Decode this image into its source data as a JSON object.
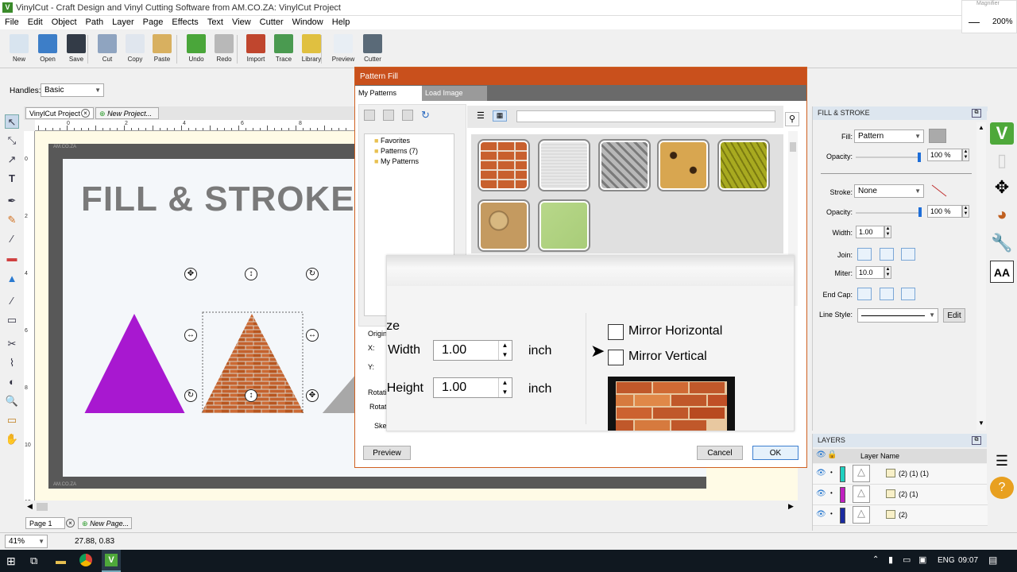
{
  "app": {
    "title": "VinylCut - Craft Design and Vinyl Cutting Software from AM.CO.ZA: VinylCut Project",
    "logo_letter": "V"
  },
  "menu": [
    "File",
    "Edit",
    "Object",
    "Path",
    "Layer",
    "Page",
    "Effects",
    "Text",
    "View",
    "Cutter",
    "Window",
    "Help"
  ],
  "toolbar": [
    {
      "label": "New",
      "icon": "new-file-icon",
      "color": "#d8e4ef"
    },
    {
      "label": "Open",
      "icon": "open-folder-icon",
      "color": "#3d7ec8"
    },
    {
      "label": "Save",
      "icon": "save-disk-icon",
      "color": "#333b47"
    },
    {
      "label": "Cut",
      "icon": "scissors-icon",
      "color": "#8fa4c0"
    },
    {
      "label": "Copy",
      "icon": "copy-icon",
      "color": "#e0e6ee"
    },
    {
      "label": "Paste",
      "icon": "paste-icon",
      "color": "#d8b060"
    },
    {
      "label": "Undo",
      "icon": "undo-icon",
      "color": "#4aa63a"
    },
    {
      "label": "Redo",
      "icon": "redo-icon",
      "color": "#b8b8b8"
    },
    {
      "label": "Import",
      "icon": "import-svg-icon",
      "color": "#c0462e"
    },
    {
      "label": "Trace",
      "icon": "trace-icon",
      "color": "#4a9a50"
    },
    {
      "label": "Library",
      "icon": "library-star-icon",
      "color": "#e0c040"
    },
    {
      "label": "Preview",
      "icon": "preview-magnifier-icon",
      "color": "#e8eef4"
    },
    {
      "label": "Cutter",
      "icon": "cutter-knife-icon",
      "color": "#5a6a78"
    }
  ],
  "handles": {
    "label": "Handles:",
    "value": "Basic"
  },
  "magnifier": {
    "title": "Magnifier",
    "minus": "—",
    "zoom": "200%"
  },
  "doc_tabs": {
    "current": "VinylCut Project",
    "new": "New Project..."
  },
  "ruler_marks": [
    "0",
    "2",
    "4",
    "6",
    "8",
    "10"
  ],
  "ruler_v_marks": [
    "0",
    "2",
    "4",
    "6",
    "8",
    "10",
    "12"
  ],
  "canvas": {
    "heading": "FILL & STROKE",
    "watermark": "AM.CO.ZA"
  },
  "dialog": {
    "title": "Pattern Fill",
    "tabs": [
      "My Patterns",
      "Load Image"
    ],
    "tree": [
      "Favorites",
      "Patterns (7)",
      "My Patterns"
    ],
    "patterns": [
      "brick",
      "linen",
      "diamond-plate",
      "leopard",
      "honeycomb-green",
      "stone",
      "paper-green"
    ],
    "left_labels": {
      "origin": "Origin",
      "x": "X:",
      "y": "Y:",
      "rotation": "Rotation",
      "rotate": "Rotate",
      "skew": "Skew"
    },
    "popup": {
      "section": "Size",
      "width_label": "Width:",
      "width_value": "1.00",
      "height_label": "Height:",
      "height_value": "1.00",
      "unit": "inch",
      "mirror_h": "Mirror Horizontal",
      "mirror_v": "Mirror Vertical"
    },
    "buttons": {
      "preview": "Preview",
      "cancel": "Cancel",
      "ok": "OK"
    }
  },
  "fill_stroke": {
    "title": "FILL & STROKE",
    "fill_label": "Fill:",
    "fill_value": "Pattern",
    "opacity_label": "Opacity:",
    "opacity_value": "100 %",
    "stroke_label": "Stroke:",
    "stroke_value": "None",
    "stroke_opacity_value": "100 %",
    "width_label": "Width:",
    "width_value": "1.00",
    "join_label": "Join:",
    "miter_label": "Miter:",
    "miter_value": "10.0",
    "endcap_label": "End Cap:",
    "linestyle_label": "Line Style:",
    "edit_label": "Edit"
  },
  "layers": {
    "title": "LAYERS",
    "header": "Layer Name",
    "rows": [
      {
        "name": "(2) (1) (1)",
        "color": "#20d0c0"
      },
      {
        "name": "(2) (1)",
        "color": "#c020c0"
      },
      {
        "name": "(2)",
        "color": "#1a2aa0"
      }
    ]
  },
  "page_tabs": {
    "current": "Page 1",
    "new": "New Page..."
  },
  "status": {
    "zoom": "41%",
    "coords": "27.88, 0.83"
  },
  "taskbar": {
    "lang": "ENG",
    "time": "09:07"
  },
  "colors": {
    "accent": "#c9501c",
    "purple": "#a818d0",
    "panel_head": "#dde6ef"
  }
}
